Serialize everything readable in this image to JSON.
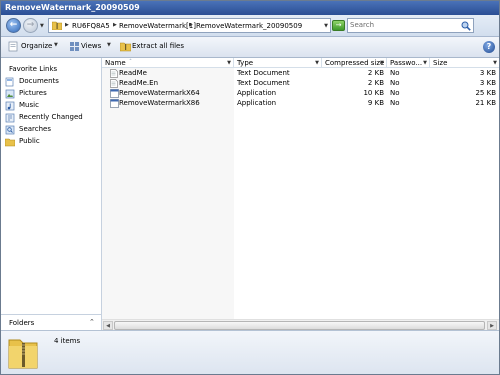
{
  "window": {
    "title": "RemoveWatermark_20090509"
  },
  "address": {
    "crumbs": [
      "RU6FQ8A5",
      "RemoveWatermark[1]",
      "RemoveWatermark_20090509"
    ]
  },
  "search": {
    "placeholder": "Search"
  },
  "toolbar": {
    "organize": "Organize",
    "views": "Views",
    "extract": "Extract all files"
  },
  "nav": {
    "header": "Favorite Links",
    "items": [
      {
        "label": "Documents",
        "icon": "documents-icon"
      },
      {
        "label": "Pictures",
        "icon": "pictures-icon"
      },
      {
        "label": "Music",
        "icon": "music-icon"
      },
      {
        "label": "Recently Changed",
        "icon": "recent-icon"
      },
      {
        "label": "Searches",
        "icon": "searches-icon"
      },
      {
        "label": "Public",
        "icon": "public-folder-icon"
      }
    ],
    "folders_label": "Folders"
  },
  "columns": {
    "name": "Name",
    "type": "Type",
    "compressed": "Compressed size",
    "password": "Passwo...",
    "size": "Size"
  },
  "files": [
    {
      "name": "ReadMe",
      "type": "Text Document",
      "compressed": "2 KB",
      "password": "No",
      "size": "3 KB",
      "icon": "text-file-icon"
    },
    {
      "name": "ReadMe.En",
      "type": "Text Document",
      "compressed": "2 KB",
      "password": "No",
      "size": "3 KB",
      "icon": "text-file-icon"
    },
    {
      "name": "RemoveWatermarkX64",
      "type": "Application",
      "compressed": "10 KB",
      "password": "No",
      "size": "25 KB",
      "icon": "application-icon"
    },
    {
      "name": "RemoveWatermarkX86",
      "type": "Application",
      "compressed": "9 KB",
      "password": "No",
      "size": "21 KB",
      "icon": "application-icon"
    }
  ],
  "details": {
    "count": "4 items"
  },
  "colors": {
    "titlebar": "#2a4e94",
    "folder": "#e8c14a",
    "go": "#3e9a2a"
  }
}
